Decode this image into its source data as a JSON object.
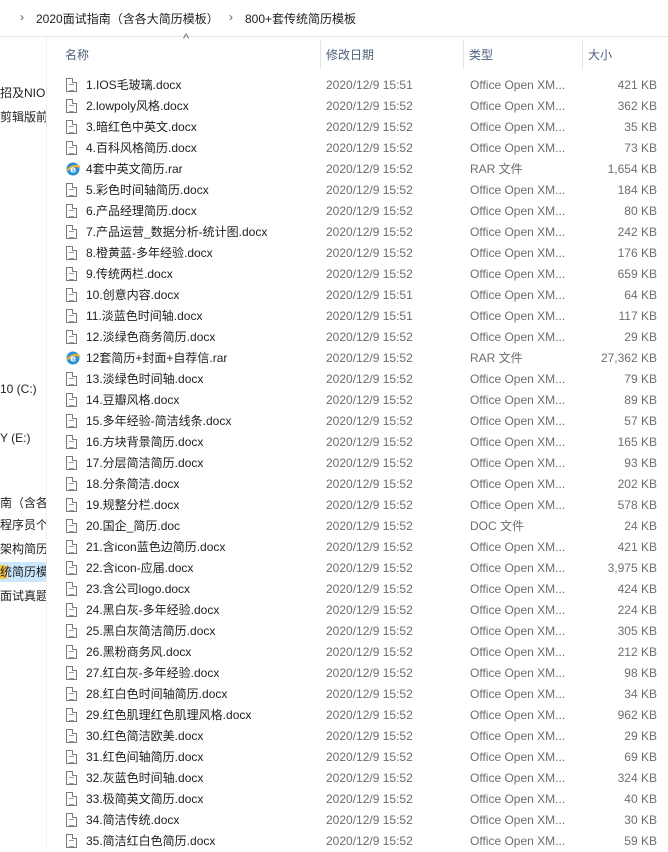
{
  "breadcrumb": {
    "items": [
      "2020面试指南（含各大简历模板）",
      "800+套传统简历模板"
    ],
    "separator": "›"
  },
  "nav_pane": {
    "items": [
      {
        "label": "招及NIO内",
        "selected": false
      },
      {
        "label": "剪辑版前",
        "selected": false
      },
      {
        "label": "10 (C:)",
        "selected": false
      },
      {
        "label": "Y (E:)",
        "selected": false
      },
      {
        "label": "南（含各",
        "selected": false
      },
      {
        "label": "程序员个人",
        "selected": false
      },
      {
        "label": "架构简历模",
        "selected": false
      },
      {
        "label": "统简历模",
        "selected": true
      },
      {
        "label": "面试真题",
        "selected": false
      }
    ]
  },
  "columns": {
    "name": "名称",
    "date": "修改日期",
    "type": "类型",
    "size": "大小"
  },
  "sort_indicator": "^",
  "files": [
    {
      "name": "1.IOS毛玻璃.docx",
      "date": "2020/12/9 15:51",
      "type": "Office Open XM...",
      "size": "421 KB",
      "icon": "doc"
    },
    {
      "name": "2.lowpoly风格.docx",
      "date": "2020/12/9 15:52",
      "type": "Office Open XM...",
      "size": "362 KB",
      "icon": "doc"
    },
    {
      "name": "3.暗红色中英文.docx",
      "date": "2020/12/9 15:52",
      "type": "Office Open XM...",
      "size": "35 KB",
      "icon": "doc"
    },
    {
      "name": "4.百科风格简历.docx",
      "date": "2020/12/9 15:52",
      "type": "Office Open XM...",
      "size": "73 KB",
      "icon": "doc"
    },
    {
      "name": "4套中英文简历.rar",
      "date": "2020/12/9 15:52",
      "type": "RAR 文件",
      "size": "1,654 KB",
      "icon": "rar"
    },
    {
      "name": "5.彩色时间轴简历.docx",
      "date": "2020/12/9 15:52",
      "type": "Office Open XM...",
      "size": "184 KB",
      "icon": "doc"
    },
    {
      "name": "6.产品经理简历.docx",
      "date": "2020/12/9 15:52",
      "type": "Office Open XM...",
      "size": "80 KB",
      "icon": "doc"
    },
    {
      "name": "7.产品运营_数据分析-统计图.docx",
      "date": "2020/12/9 15:52",
      "type": "Office Open XM...",
      "size": "242 KB",
      "icon": "doc"
    },
    {
      "name": "8.橙黄蓝-多年经验.docx",
      "date": "2020/12/9 15:52",
      "type": "Office Open XM...",
      "size": "176 KB",
      "icon": "doc"
    },
    {
      "name": "9.传统两栏.docx",
      "date": "2020/12/9 15:52",
      "type": "Office Open XM...",
      "size": "659 KB",
      "icon": "doc"
    },
    {
      "name": "10.创意内容.docx",
      "date": "2020/12/9 15:51",
      "type": "Office Open XM...",
      "size": "64 KB",
      "icon": "doc"
    },
    {
      "name": "11.淡蓝色时间轴.docx",
      "date": "2020/12/9 15:51",
      "type": "Office Open XM...",
      "size": "117 KB",
      "icon": "doc"
    },
    {
      "name": "12.淡绿色商务简历.docx",
      "date": "2020/12/9 15:52",
      "type": "Office Open XM...",
      "size": "29 KB",
      "icon": "doc"
    },
    {
      "name": "12套简历+封面+自荐信.rar",
      "date": "2020/12/9 15:52",
      "type": "RAR 文件",
      "size": "27,362 KB",
      "icon": "rar"
    },
    {
      "name": "13.淡绿色时间轴.docx",
      "date": "2020/12/9 15:52",
      "type": "Office Open XM...",
      "size": "79 KB",
      "icon": "doc"
    },
    {
      "name": "14.豆瓣风格.docx",
      "date": "2020/12/9 15:52",
      "type": "Office Open XM...",
      "size": "89 KB",
      "icon": "doc"
    },
    {
      "name": "15.多年经验-简洁线条.docx",
      "date": "2020/12/9 15:52",
      "type": "Office Open XM...",
      "size": "57 KB",
      "icon": "doc"
    },
    {
      "name": "16.方块背景简历.docx",
      "date": "2020/12/9 15:52",
      "type": "Office Open XM...",
      "size": "165 KB",
      "icon": "doc"
    },
    {
      "name": "17.分层简洁简历.docx",
      "date": "2020/12/9 15:52",
      "type": "Office Open XM...",
      "size": "93 KB",
      "icon": "doc"
    },
    {
      "name": "18.分条简洁.docx",
      "date": "2020/12/9 15:52",
      "type": "Office Open XM...",
      "size": "202 KB",
      "icon": "doc"
    },
    {
      "name": "19.规整分栏.docx",
      "date": "2020/12/9 15:52",
      "type": "Office Open XM...",
      "size": "578 KB",
      "icon": "doc"
    },
    {
      "name": "20.国企_简历.doc",
      "date": "2020/12/9 15:52",
      "type": "DOC 文件",
      "size": "24 KB",
      "icon": "doc"
    },
    {
      "name": "21.含icon蓝色边简历.docx",
      "date": "2020/12/9 15:52",
      "type": "Office Open XM...",
      "size": "421 KB",
      "icon": "doc"
    },
    {
      "name": "22.含icon-应届.docx",
      "date": "2020/12/9 15:52",
      "type": "Office Open XM...",
      "size": "3,975 KB",
      "icon": "doc"
    },
    {
      "name": "23.含公司logo.docx",
      "date": "2020/12/9 15:52",
      "type": "Office Open XM...",
      "size": "424 KB",
      "icon": "doc"
    },
    {
      "name": "24.黑白灰-多年经验.docx",
      "date": "2020/12/9 15:52",
      "type": "Office Open XM...",
      "size": "224 KB",
      "icon": "doc"
    },
    {
      "name": "25.黑白灰简洁简历.docx",
      "date": "2020/12/9 15:52",
      "type": "Office Open XM...",
      "size": "305 KB",
      "icon": "doc"
    },
    {
      "name": "26.黑粉商务风.docx",
      "date": "2020/12/9 15:52",
      "type": "Office Open XM...",
      "size": "212 KB",
      "icon": "doc"
    },
    {
      "name": "27.红白灰-多年经验.docx",
      "date": "2020/12/9 15:52",
      "type": "Office Open XM...",
      "size": "98 KB",
      "icon": "doc"
    },
    {
      "name": "28.红白色时间轴简历.docx",
      "date": "2020/12/9 15:52",
      "type": "Office Open XM...",
      "size": "34 KB",
      "icon": "doc"
    },
    {
      "name": "29.红色肌理红色肌理风格.docx",
      "date": "2020/12/9 15:52",
      "type": "Office Open XM...",
      "size": "962 KB",
      "icon": "doc"
    },
    {
      "name": "30.红色简洁欧美.docx",
      "date": "2020/12/9 15:52",
      "type": "Office Open XM...",
      "size": "29 KB",
      "icon": "doc"
    },
    {
      "name": "31.红色间轴简历.docx",
      "date": "2020/12/9 15:52",
      "type": "Office Open XM...",
      "size": "69 KB",
      "icon": "doc"
    },
    {
      "name": "32.灰蓝色时间轴.docx",
      "date": "2020/12/9 15:52",
      "type": "Office Open XM...",
      "size": "324 KB",
      "icon": "doc"
    },
    {
      "name": "33.极简英文简历.docx",
      "date": "2020/12/9 15:52",
      "type": "Office Open XM...",
      "size": "40 KB",
      "icon": "doc"
    },
    {
      "name": "34.简洁传统.docx",
      "date": "2020/12/9 15:52",
      "type": "Office Open XM...",
      "size": "30 KB",
      "icon": "doc"
    },
    {
      "name": "35.简洁红白色简历.docx",
      "date": "2020/12/9 15:52",
      "type": "Office Open XM...",
      "size": "59 KB",
      "icon": "doc"
    }
  ],
  "colors": {
    "header_text": "#4c607a",
    "secondary_text": "#6d6d6d",
    "selection": "#cce8ff",
    "folder": "#f4c542"
  }
}
